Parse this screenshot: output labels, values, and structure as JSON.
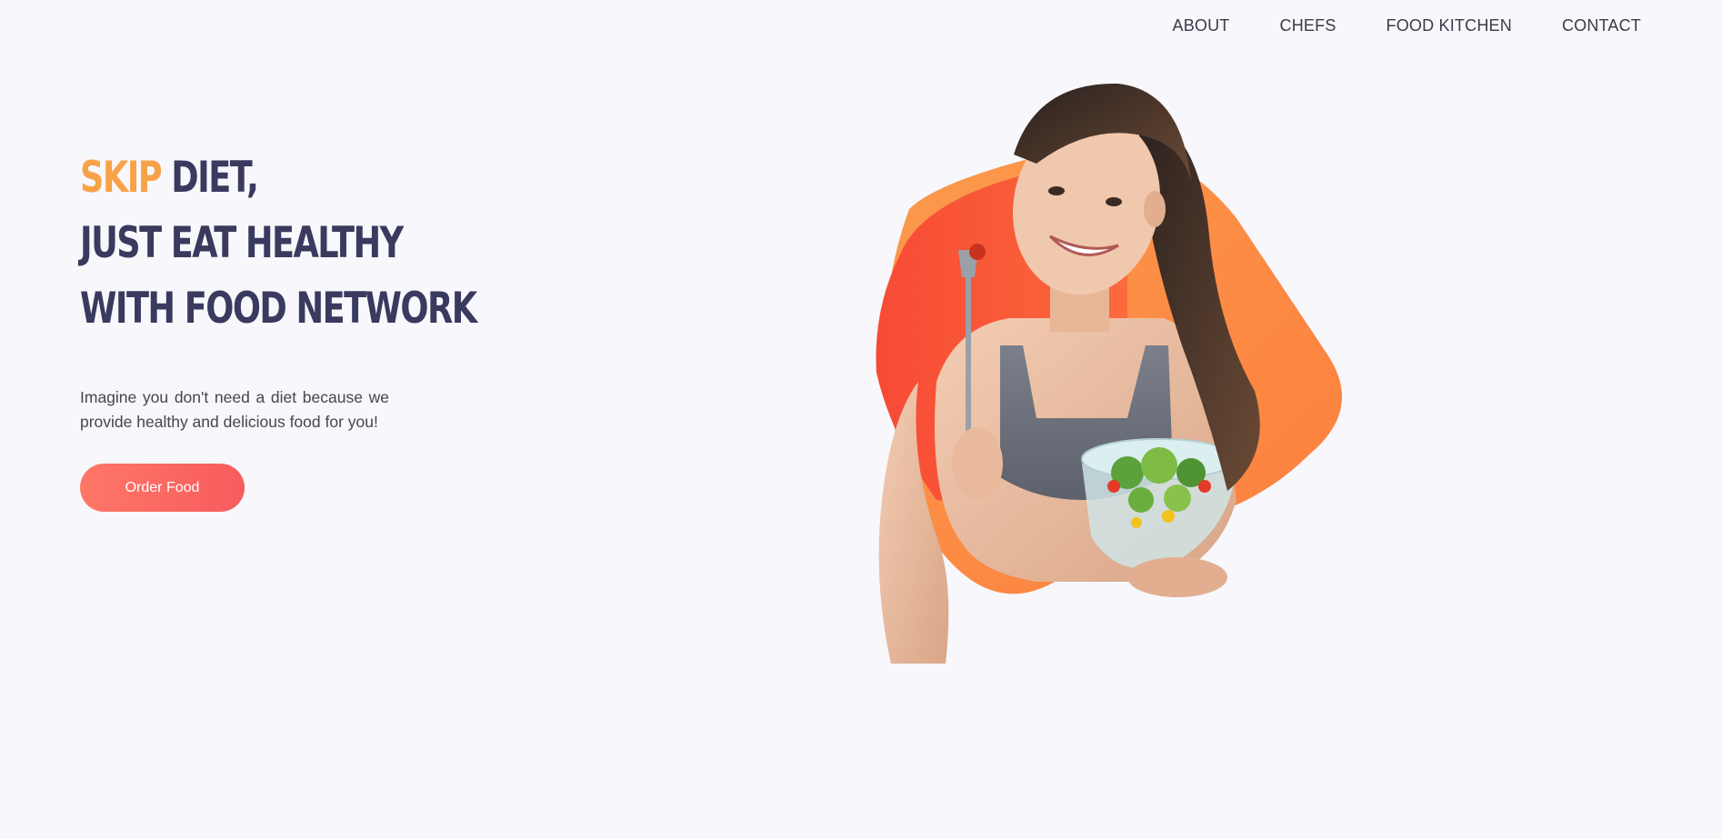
{
  "nav": {
    "items": [
      {
        "label": "ABOUT"
      },
      {
        "label": "CHEFS"
      },
      {
        "label": "FOOD KITCHEN"
      },
      {
        "label": "CONTACT"
      }
    ]
  },
  "hero": {
    "headline_accent": "SKIP",
    "headline_line1_rest": " DIET,",
    "headline_line2": "JUST EAT HEALTHY",
    "headline_line3": "WITH FOOD NETWORK",
    "lead": "Imagine you don't need a diet because we provide healthy and delicious food for you!",
    "cta_label": "Order Food"
  },
  "colors": {
    "background": "#f7f7fc",
    "headline": "#393a5e",
    "accent": "#f8a247",
    "cta_start": "#fe7767",
    "cta_end": "#f75b5e",
    "blob_outer": "#fb8a45",
    "blob_inner": "#f8533a"
  },
  "icons": {
    "hero_image": "woman-eating-salad-illustration"
  }
}
